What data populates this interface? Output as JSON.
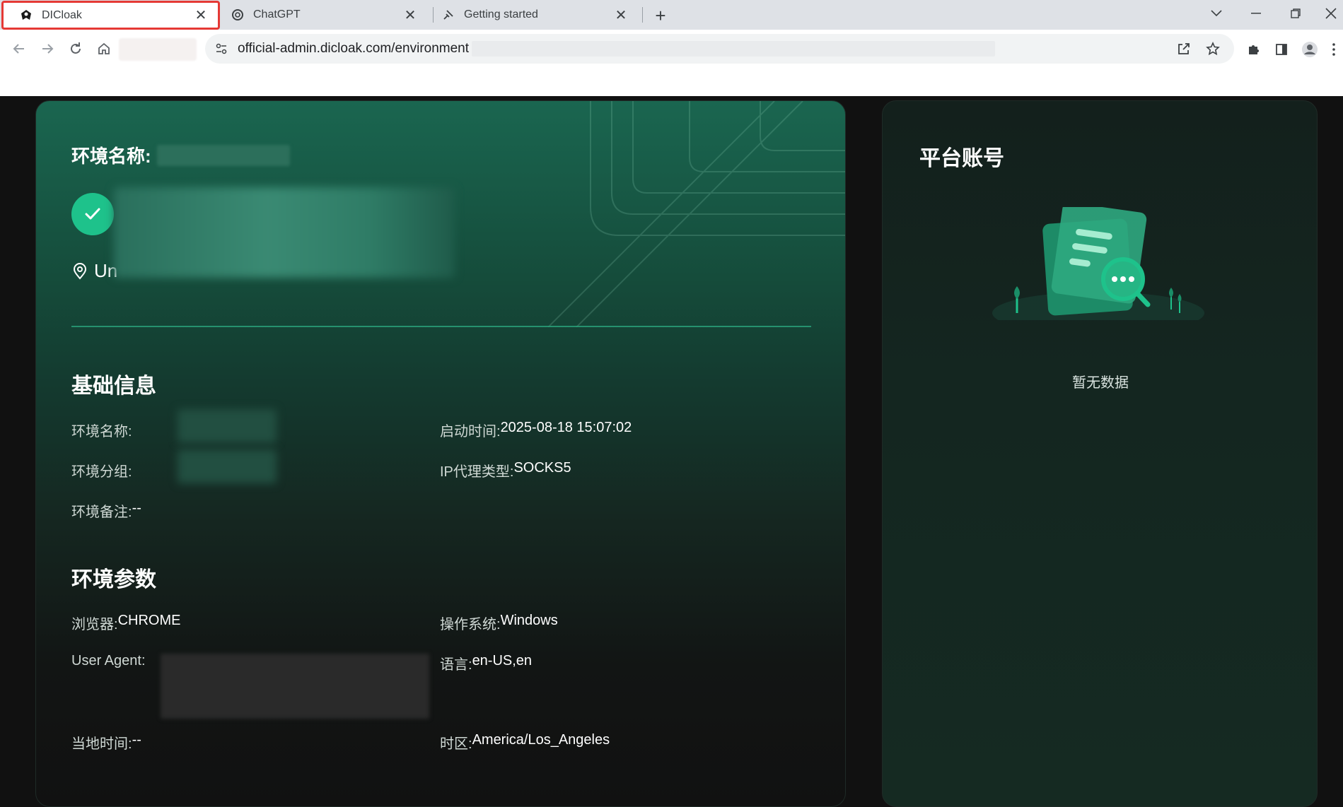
{
  "browser": {
    "tabs": [
      {
        "title": "DICloak",
        "active": true
      },
      {
        "title": "ChatGPT",
        "active": false
      },
      {
        "title": "Getting started",
        "active": false
      }
    ],
    "url": "official-admin.dicloak.com/environment"
  },
  "env_card": {
    "name_label": "环境名称:",
    "location_partial": "Un",
    "basic_info": {
      "title": "基础信息",
      "env_name_label": "环境名称:",
      "env_group_label": "环境分组:",
      "env_note_label": "环境备注:",
      "env_note_value": "--",
      "start_time_label": "启动时间:",
      "start_time_value": "2025-08-18 15:07:02",
      "proxy_type_label": "IP代理类型:",
      "proxy_type_value": "SOCKS5"
    },
    "env_params": {
      "title": "环境参数",
      "browser_label": "浏览器:",
      "browser_value": "CHROME",
      "os_label": "操作系统:",
      "os_value": "Windows",
      "ua_label": "User Agent:",
      "lang_label": "语言:",
      "lang_value": "en-US,en",
      "local_time_label": "当地时间:",
      "local_time_value": "--",
      "timezone_label": "时区:",
      "timezone_value": "America/Los_Angeles"
    }
  },
  "account_card": {
    "title": "平台账号",
    "empty_text": "暂无数据"
  },
  "colors": {
    "accent": "#1ec28b",
    "active_tab_border": "#e53935"
  }
}
